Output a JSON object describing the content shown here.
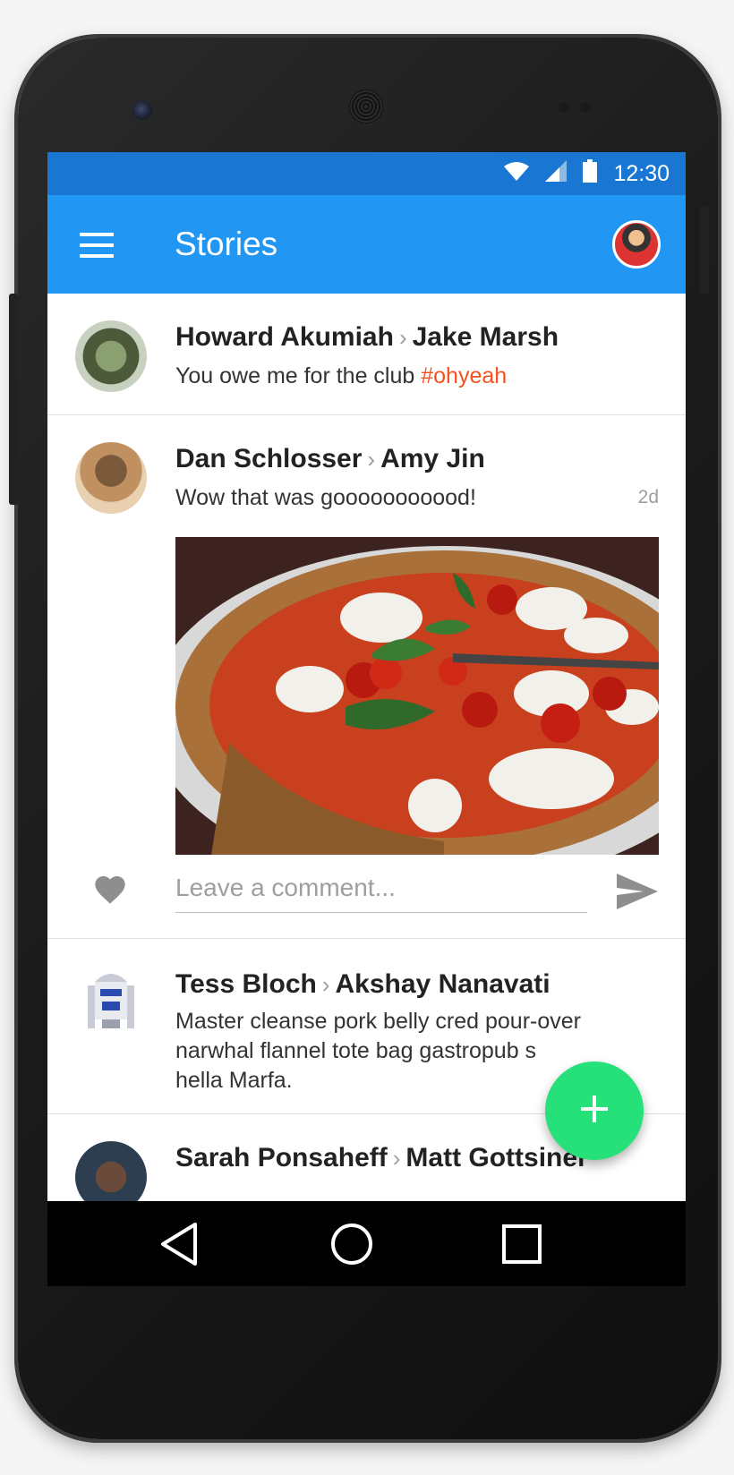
{
  "status_bar": {
    "time": "12:30",
    "icons": [
      "wifi-icon",
      "signal-icon",
      "battery-icon"
    ]
  },
  "app_bar": {
    "title": "Stories",
    "menu_icon": "menu-icon",
    "avatar": "profile-avatar"
  },
  "stories": [
    {
      "author": "Howard Akumiah",
      "recipient": "Jake Marsh",
      "text": "You owe me for the club ",
      "hashtag": "#ohyeah"
    },
    {
      "author": "Dan Schlosser",
      "recipient": "Amy Jin",
      "text": "Wow that was gooooooooood!",
      "time": "2d"
    },
    {
      "author": "Tess Bloch",
      "recipient": "Akshay Nanavati",
      "text_lines": [
        "Master cleanse pork belly cred pour-over",
        "narwhal flannel tote bag gastropub s",
        "hella Marfa."
      ]
    },
    {
      "author": "Sarah Ponsaheff",
      "recipient": "Matt Gottsiner"
    }
  ],
  "comment": {
    "placeholder": "Leave a comment..."
  },
  "colors": {
    "status_bar": "#1976D2",
    "app_bar": "#2196F3",
    "hashtag": "#F4511E",
    "fab": "#26E07A"
  },
  "fab_icon": "plus-icon",
  "nav_icons": [
    "back-icon",
    "home-icon",
    "recents-icon"
  ]
}
